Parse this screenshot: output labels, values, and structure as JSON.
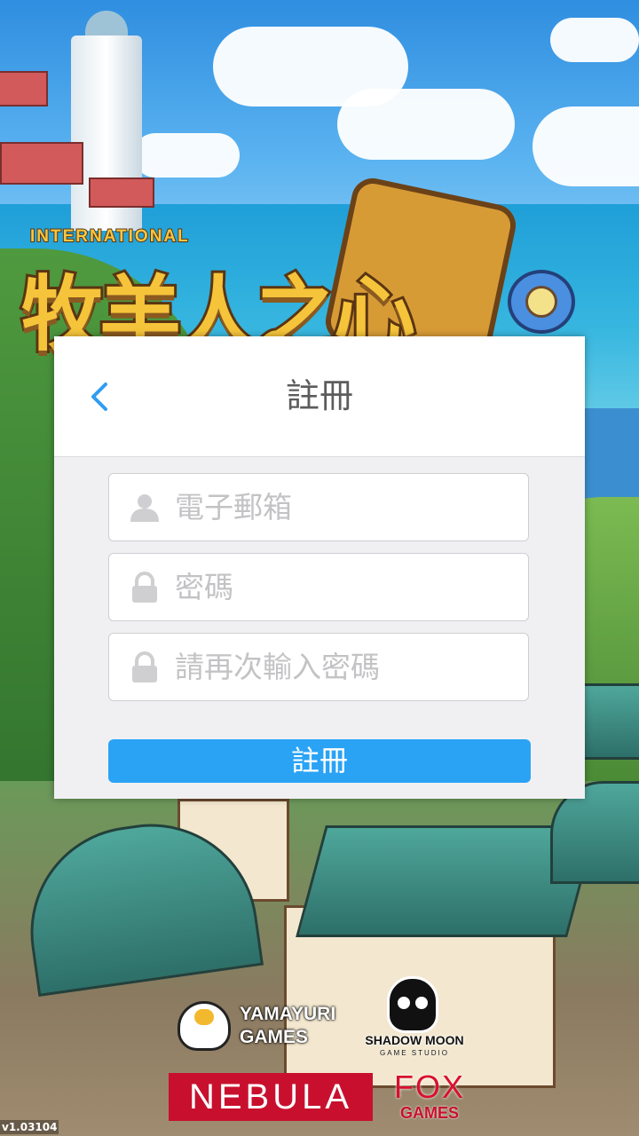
{
  "logo": {
    "international_label": "INTERNATIONAL",
    "title_art_text": "牧羊人之心"
  },
  "dialog": {
    "title": "註冊",
    "back_icon": "chevron-left-icon",
    "fields": [
      {
        "placeholder": "電子郵箱",
        "icon": "user-icon",
        "value": ""
      },
      {
        "placeholder": "密碼",
        "icon": "lock-icon",
        "value": ""
      },
      {
        "placeholder": "請再次輸入密碼",
        "icon": "lock-icon",
        "value": ""
      }
    ],
    "submit_label": "註冊"
  },
  "publishers": {
    "yamayuri_line1": "YAMAYURI",
    "yamayuri_line2": "GAMES",
    "shadowmoon_name": "SHADOW MOON",
    "shadowmoon_sub": "GAME STUDIO",
    "nebula": "NEBULA",
    "fox_line1": "FOX",
    "fox_line2": "GAMES"
  },
  "version": "v1.03104",
  "colors": {
    "accent": "#2aa3f5",
    "back_chevron": "#2f9df0",
    "placeholder": "#c3c3c6",
    "nebula_red": "#c8102e"
  }
}
